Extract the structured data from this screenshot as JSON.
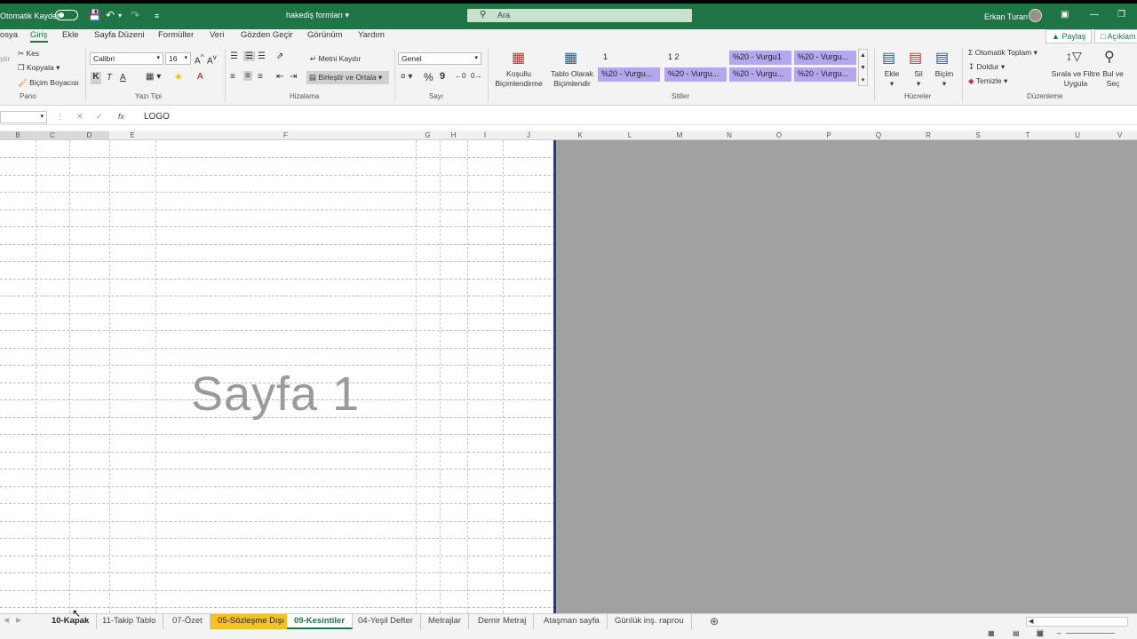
{
  "titlebar": {
    "autosave_label": "Otomatik Kaydet",
    "doc_title": "hakediş formları",
    "search_placeholder": "Ara",
    "user_name": "Erkan Turan"
  },
  "menu": {
    "items": [
      "osya",
      "Giriş",
      "Ekle",
      "Sayfa Düzeni",
      "Formüller",
      "Veri",
      "Gözden Geçir",
      "Görünüm",
      "Yardım"
    ],
    "active": "Giriş",
    "share": "Paylaş",
    "comments": "Açıklam"
  },
  "ribbon": {
    "clipboard": {
      "cut": "Kes",
      "copy": "Kopyala",
      "format_painter": "Biçim Boyacısı",
      "paste_fragment": "ştir",
      "group": "Pano"
    },
    "font": {
      "name": "Calibri",
      "size": "16",
      "bold": "K",
      "italic": "T",
      "underline": "A",
      "group": "Yazı Tipi"
    },
    "alignment": {
      "wrap": "Metni Kaydır",
      "merge": "Birleştir ve Ortala",
      "group": "Hizalama"
    },
    "number": {
      "format": "Genel",
      "percent": "%",
      "comma": "9",
      "group": "Sayı"
    },
    "styles": {
      "conditional": "Koşullu Biçimlendirme",
      "table": "Tablo Olarak Biçimlendir",
      "cells": [
        "1",
        "1 2",
        "%20 - Vurgu1",
        "%20 - Vurgu...",
        "%20 - Vurgu...",
        "%20 - Vurgu...",
        "%20 - Vurgu...",
        "%20 - Vurgu..."
      ],
      "group": "Stiller"
    },
    "cells": {
      "insert": "Ekle",
      "delete": "Sil",
      "format": "Biçim",
      "group": "Hücreler"
    },
    "editing": {
      "autosum": "Otomatik Toplam",
      "fill": "Doldur",
      "clear": "Temizle",
      "sort": "Sırala ve Filtre Uygula",
      "find": "Bul ve Seç",
      "group": "Düzenleme"
    }
  },
  "formula_bar": {
    "content": "LOGO",
    "fx": "fx"
  },
  "columns": [
    "B",
    "C",
    "D",
    "E",
    "F",
    "G",
    "H",
    "I",
    "J",
    "K",
    "L",
    "M",
    "N",
    "O",
    "P",
    "Q",
    "R",
    "S",
    "T",
    "U",
    "V"
  ],
  "watermark": "Sayfa 1",
  "tabs": [
    "10-Kapak",
    "11-Takip Tablo",
    "07-Özet",
    "05-Sözleşme Dışı",
    "09-Kesintiler",
    "04-Yeşil Defter",
    "Metrajlar",
    "Demir Metraj",
    "Ataşman sayfa",
    "Günlük inş. raprou"
  ],
  "colors": {
    "excel_green": "#1f7446",
    "tab_gold": "#f6c223",
    "page_edge": "#203a8c",
    "gray_area": "#a0a0a0",
    "accent_style": "#b4a7f0"
  }
}
